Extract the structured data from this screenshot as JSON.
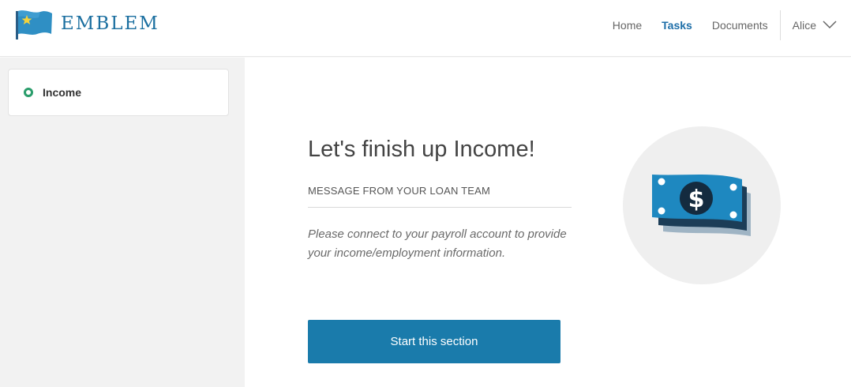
{
  "brand": {
    "name": "EMBLEM",
    "logo_icon": "flag-icon"
  },
  "nav": {
    "items": [
      {
        "label": "Home",
        "active": false
      },
      {
        "label": "Tasks",
        "active": true
      },
      {
        "label": "Documents",
        "active": false
      }
    ],
    "user": {
      "name": "Alice",
      "menu_icon": "chevron-down-icon"
    }
  },
  "sidebar": {
    "items": [
      {
        "label": "Income",
        "status_icon": "status-ring-icon"
      }
    ]
  },
  "main": {
    "title": "Let's finish up Income!",
    "message_heading": "MESSAGE FROM YOUR LOAN TEAM",
    "message_body": "Please connect to your payroll account to provide your income/employment information.",
    "cta_label": "Start this section",
    "illustration_icon": "money-icon"
  },
  "colors": {
    "accent": "#1d6ea8",
    "button": "#1a7bab",
    "status_ring": "#2a9d6b",
    "sidebar_bg": "#f2f2f2"
  }
}
